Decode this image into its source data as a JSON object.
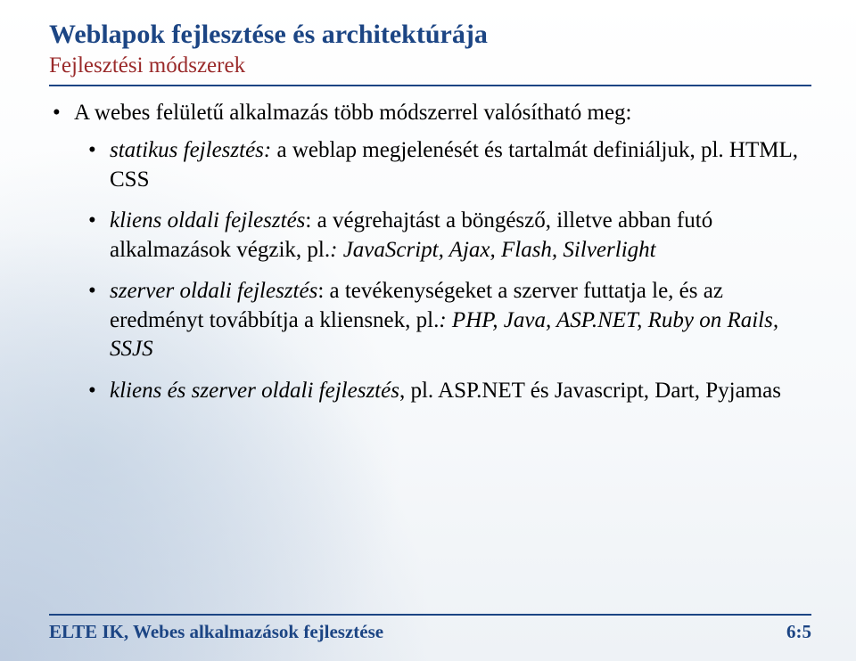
{
  "title": "Weblapok fejlesztése és architektúrája",
  "subtitle": "Fejlesztési módszerek",
  "bullets": {
    "intro": "A webes felületű alkalmazás több módszerrel valósítható meg:",
    "items": [
      {
        "lead_italic": "statikus fejlesztés:",
        "rest": " a weblap megjelenését és tartalmát definiáljuk, pl. HTML, CSS"
      },
      {
        "lead_italic": "kliens oldali fejlesztés",
        "rest": ": a végrehajtást a böngésző, illetve abban futó alkalmazások végzik, pl.",
        "tail_italic": ": JavaScript, Ajax, Flash, Silverlight"
      },
      {
        "lead_italic": "szerver oldali fejlesztés",
        "rest": ": a tevékenységeket a szerver futtatja le, és az eredményt továbbítja a kliensnek, pl.",
        "tail_italic": ": PHP, Java, ASP.NET, Ruby on Rails, SSJS"
      },
      {
        "lead_italic": "kliens és szerver oldali fejlesztés",
        "rest": ", pl. ASP.NET és Javascript, Dart, Pyjamas"
      }
    ]
  },
  "footer": {
    "left": "ELTE IK, Webes alkalmazások fejlesztése",
    "right": "6:5"
  }
}
